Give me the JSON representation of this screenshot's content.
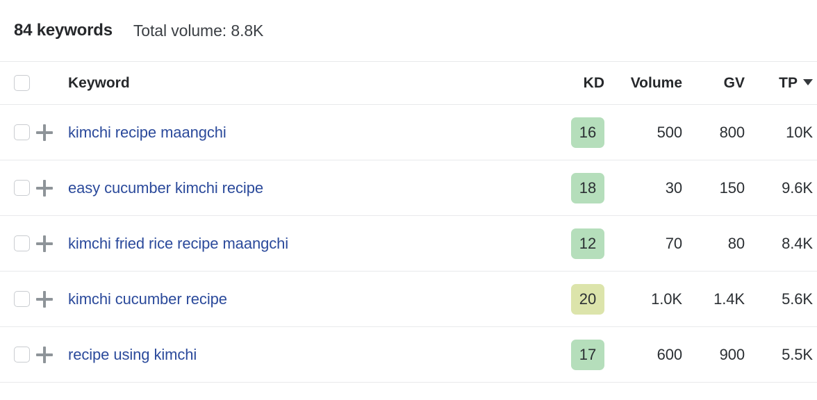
{
  "summary": {
    "count_label": "84 keywords",
    "volume_label": "Total volume: 8.8K"
  },
  "table": {
    "headers": {
      "keyword": "Keyword",
      "kd": "KD",
      "volume": "Volume",
      "gv": "GV",
      "tp": "TP"
    },
    "sort": {
      "column": "TP",
      "direction": "desc",
      "icon": "caret-down-icon"
    },
    "select_all_checked": false,
    "rows": [
      {
        "keyword": "kimchi recipe maangchi",
        "kd": "16",
        "kd_color": "#b5debb",
        "volume": "500",
        "gv": "800",
        "tp": "10K",
        "checked": false,
        "add_icon": "plus-icon"
      },
      {
        "keyword": "easy cucumber kimchi recipe",
        "kd": "18",
        "kd_color": "#b5debb",
        "volume": "30",
        "gv": "150",
        "tp": "9.6K",
        "checked": false,
        "add_icon": "plus-icon"
      },
      {
        "keyword": "kimchi fried rice recipe maangchi",
        "kd": "12",
        "kd_color": "#b5debb",
        "volume": "70",
        "gv": "80",
        "tp": "8.4K",
        "checked": false,
        "add_icon": "plus-icon"
      },
      {
        "keyword": "kimchi cucumber recipe",
        "kd": "20",
        "kd_color": "#dce4ab",
        "volume": "1.0K",
        "gv": "1.4K",
        "tp": "5.6K",
        "checked": false,
        "add_icon": "plus-icon"
      },
      {
        "keyword": "recipe using kimchi",
        "kd": "17",
        "kd_color": "#b5debb",
        "volume": "600",
        "gv": "900",
        "tp": "5.5K",
        "checked": false,
        "add_icon": "plus-icon"
      }
    ]
  },
  "colors": {
    "link": "#2b4a9b",
    "divider": "#e8e9eb",
    "text": "#2b2f33",
    "kd_easy": "#b5debb",
    "kd_medium": "#dce4ab"
  }
}
